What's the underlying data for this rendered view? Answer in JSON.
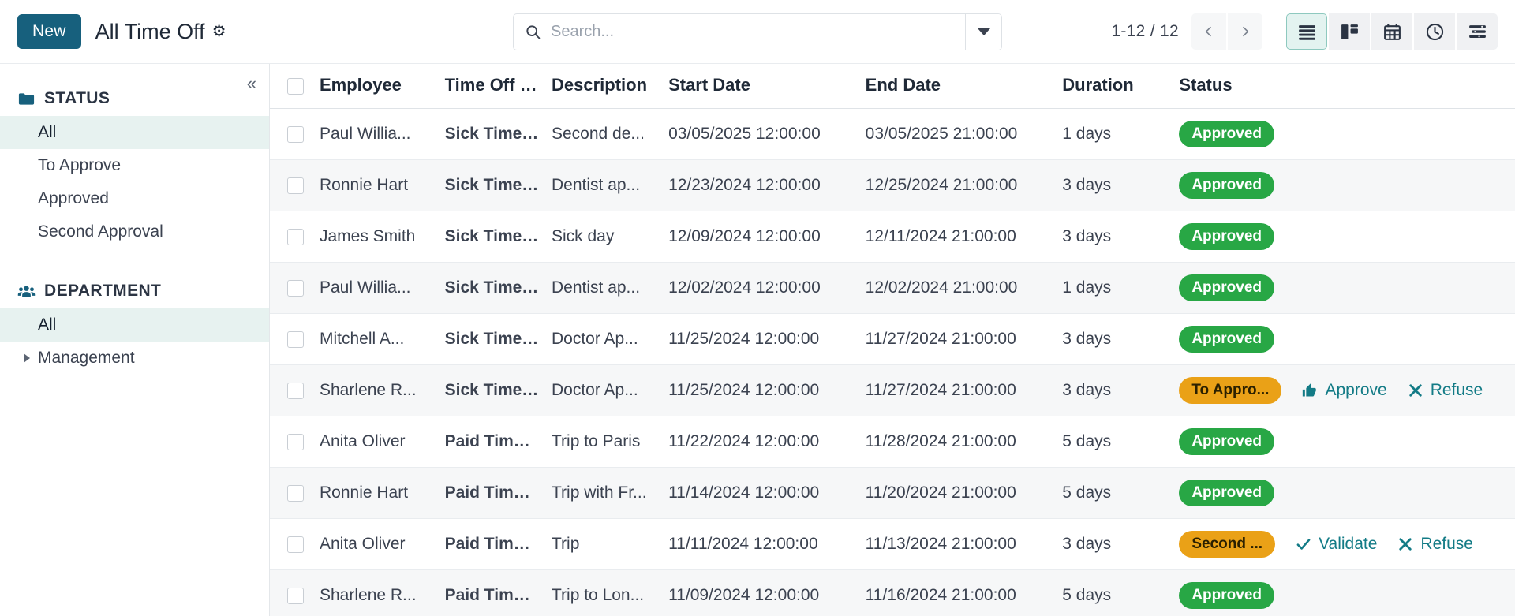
{
  "control_panel": {
    "new_button": "New",
    "breadcrumb": "All Time Off",
    "gear_icon": "gear-icon",
    "search": {
      "placeholder": "Search...",
      "value": "",
      "search_icon": "search-icon",
      "dropdown_icon": "chevron-down-icon"
    },
    "pager": {
      "count": "1-12 / 12",
      "previous_icon": "chevron-left-icon",
      "next_icon": "chevron-right-icon"
    },
    "views": [
      {
        "name": "list-view",
        "icon": "list-icon",
        "active": true
      },
      {
        "name": "kanban-view",
        "icon": "kanban-icon",
        "active": false
      },
      {
        "name": "calendar-view",
        "icon": "calendar-icon",
        "active": false
      },
      {
        "name": "activity-view",
        "icon": "clock-icon",
        "active": false
      },
      {
        "name": "gantt-view",
        "icon": "gantt-icon",
        "active": false
      }
    ]
  },
  "sidebar": {
    "collapse_icon": "double-chevron-left-icon",
    "sections": [
      {
        "title": "STATUS",
        "icon": "folder-icon",
        "items": [
          {
            "label": "All",
            "selected": true,
            "expandable": false
          },
          {
            "label": "To Approve",
            "selected": false,
            "expandable": false
          },
          {
            "label": "Approved",
            "selected": false,
            "expandable": false
          },
          {
            "label": "Second Approval",
            "selected": false,
            "expandable": false
          }
        ]
      },
      {
        "title": "DEPARTMENT",
        "icon": "people-icon",
        "items": [
          {
            "label": "All",
            "selected": true,
            "expandable": false
          },
          {
            "label": "Management",
            "selected": false,
            "expandable": true
          }
        ]
      }
    ]
  },
  "table": {
    "columns": [
      "Employee",
      "Time Off T...",
      "Description",
      "Start Date",
      "End Date",
      "Duration",
      "Status"
    ],
    "rows": [
      {
        "employee": "Paul Willia...",
        "type": "Sick Time ...",
        "description": "Second de...",
        "start": "03/05/2025 12:00:00",
        "end": "03/05/2025 21:00:00",
        "duration": "1 days",
        "status": "Approved",
        "status_kind": "approved",
        "actions": []
      },
      {
        "employee": "Ronnie Hart",
        "type": "Sick Time ...",
        "description": "Dentist ap...",
        "start": "12/23/2024 12:00:00",
        "end": "12/25/2024 21:00:00",
        "duration": "3 days",
        "status": "Approved",
        "status_kind": "approved",
        "actions": []
      },
      {
        "employee": "James Smith",
        "type": "Sick Time ...",
        "description": "Sick day",
        "start": "12/09/2024 12:00:00",
        "end": "12/11/2024 21:00:00",
        "duration": "3 days",
        "status": "Approved",
        "status_kind": "approved",
        "actions": []
      },
      {
        "employee": "Paul Willia...",
        "type": "Sick Time ...",
        "description": "Dentist ap...",
        "start": "12/02/2024 12:00:00",
        "end": "12/02/2024 21:00:00",
        "duration": "1 days",
        "status": "Approved",
        "status_kind": "approved",
        "actions": []
      },
      {
        "employee": "Mitchell A...",
        "type": "Sick Time ...",
        "description": "Doctor Ap...",
        "start": "11/25/2024 12:00:00",
        "end": "11/27/2024 21:00:00",
        "duration": "3 days",
        "status": "Approved",
        "status_kind": "approved",
        "actions": []
      },
      {
        "employee": "Sharlene R...",
        "type": "Sick Time ...",
        "description": "Doctor Ap...",
        "start": "11/25/2024 12:00:00",
        "end": "11/27/2024 21:00:00",
        "duration": "3 days",
        "status": "To Appro...",
        "status_kind": "pending",
        "actions": [
          {
            "label": "Approve",
            "icon": "thumbs-up-icon"
          },
          {
            "label": "Refuse",
            "icon": "x-mark-icon"
          }
        ]
      },
      {
        "employee": "Anita Oliver",
        "type": "Paid Time ...",
        "description": "Trip to Paris",
        "start": "11/22/2024 12:00:00",
        "end": "11/28/2024 21:00:00",
        "duration": "5 days",
        "status": "Approved",
        "status_kind": "approved",
        "actions": []
      },
      {
        "employee": "Ronnie Hart",
        "type": "Paid Time ...",
        "description": "Trip with Fr...",
        "start": "11/14/2024 12:00:00",
        "end": "11/20/2024 21:00:00",
        "duration": "5 days",
        "status": "Approved",
        "status_kind": "approved",
        "actions": []
      },
      {
        "employee": "Anita Oliver",
        "type": "Paid Time ...",
        "description": "Trip",
        "start": "11/11/2024 12:00:00",
        "end": "11/13/2024 21:00:00",
        "duration": "3 days",
        "status": "Second ...",
        "status_kind": "pending",
        "actions": [
          {
            "label": "Validate",
            "icon": "check-icon"
          },
          {
            "label": "Refuse",
            "icon": "x-mark-icon"
          }
        ]
      },
      {
        "employee": "Sharlene R...",
        "type": "Paid Time ...",
        "description": "Trip to Lon...",
        "start": "11/09/2024 12:00:00",
        "end": "11/16/2024 21:00:00",
        "duration": "5 days",
        "status": "Approved",
        "status_kind": "approved",
        "actions": []
      }
    ]
  },
  "colors": {
    "brand": "#17607d",
    "approved": "#28a745",
    "pending": "#eaa117",
    "action_link": "#137b86",
    "selected_row": "#e7f2f0"
  }
}
